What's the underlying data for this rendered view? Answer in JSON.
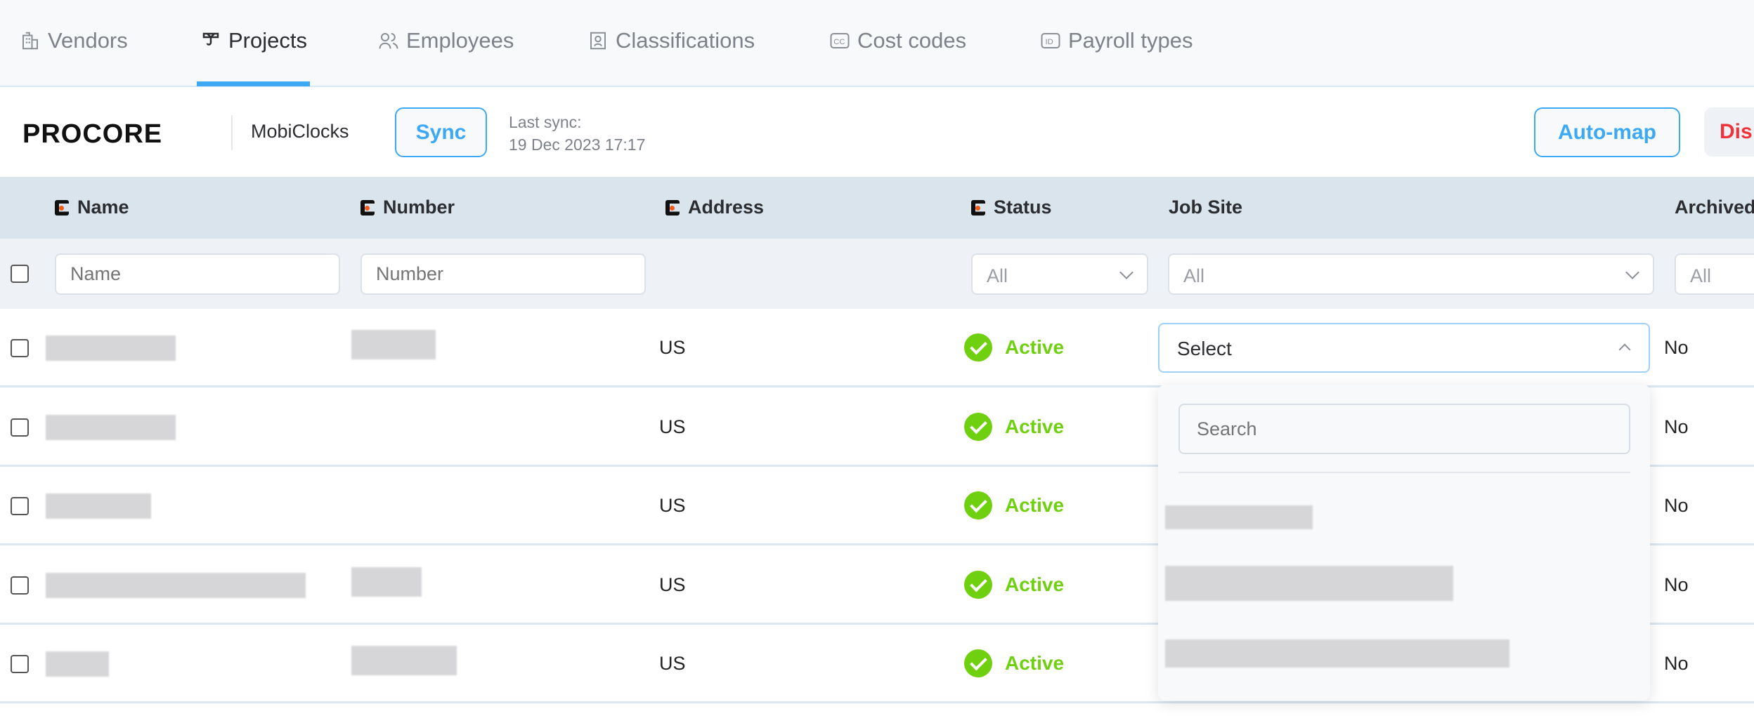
{
  "tabs": [
    {
      "label": "Vendors",
      "icon": "building-icon",
      "active": false
    },
    {
      "label": "Projects",
      "icon": "crane-icon",
      "active": true
    },
    {
      "label": "Employees",
      "icon": "users-icon",
      "active": false
    },
    {
      "label": "Classifications",
      "icon": "classification-icon",
      "active": false
    },
    {
      "label": "Cost codes",
      "icon": "cc-icon",
      "active": false
    },
    {
      "label": "Payroll types",
      "icon": "id-icon",
      "active": false
    }
  ],
  "toolbar": {
    "logo": "PROCORE",
    "app_name": "MobiClocks",
    "sync_label": "Sync",
    "last_sync_label": "Last sync:",
    "last_sync_value": "19 Dec 2023 17:17",
    "automap_label": "Auto-map",
    "disconnect_label": "Dis"
  },
  "table": {
    "headers": {
      "name": "Name",
      "number": "Number",
      "address": "Address",
      "status": "Status",
      "job_site": "Job Site",
      "archived": "Archived"
    },
    "filters": {
      "name_placeholder": "Name",
      "number_placeholder": "Number",
      "status": "All",
      "job_site": "All",
      "archived": "All"
    },
    "rows": [
      {
        "address": "US",
        "status": "Active",
        "archived": "No",
        "job_site": "Select"
      },
      {
        "address": "US",
        "status": "Active",
        "archived": "No"
      },
      {
        "address": "US",
        "status": "Active",
        "archived": "No"
      },
      {
        "address": "US",
        "status": "Active",
        "archived": "No"
      },
      {
        "address": "US",
        "status": "Active",
        "archived": "No"
      }
    ]
  },
  "dropdown": {
    "search_placeholder": "Search"
  },
  "colors": {
    "accent": "#3da9f5",
    "active": "#6fd00f",
    "danger": "#f0333a",
    "header_bg": "#dae4ed"
  }
}
